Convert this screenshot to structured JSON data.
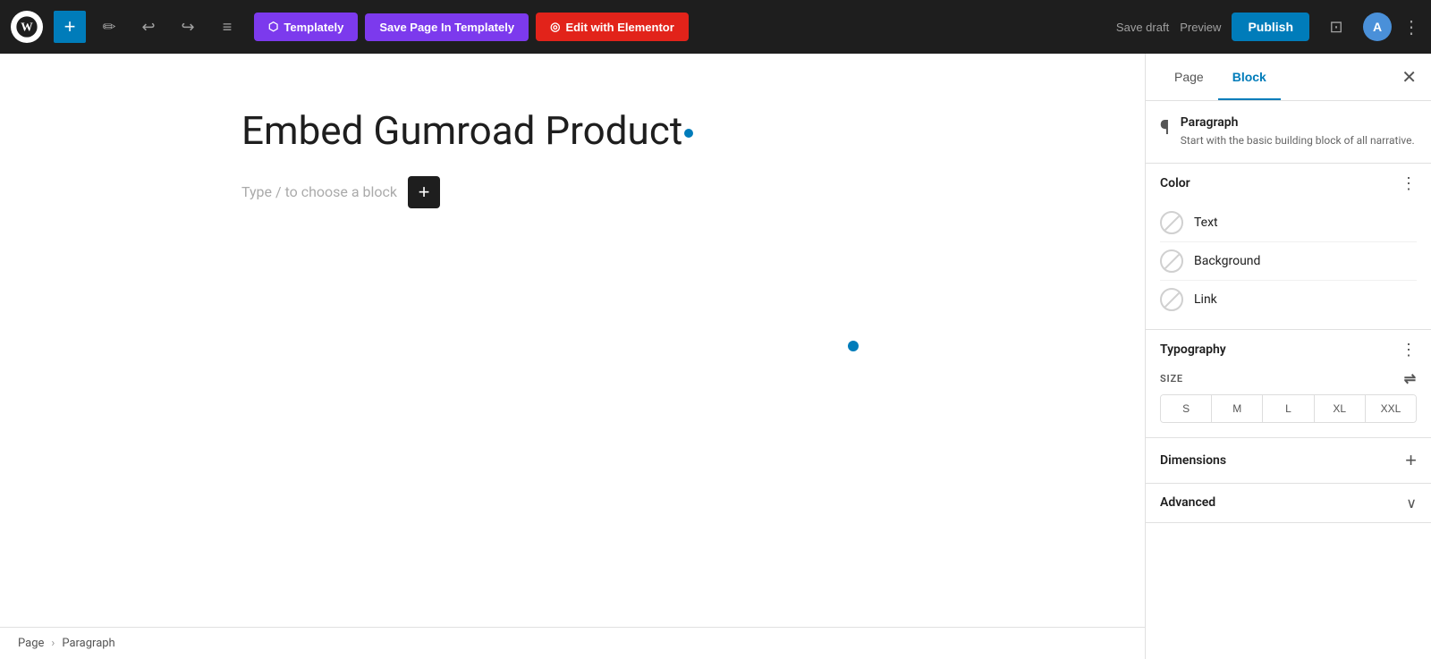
{
  "topbar": {
    "add_btn_label": "+",
    "pencil_icon": "✏",
    "undo_icon": "↩",
    "redo_icon": "↪",
    "list_icon": "≡",
    "templately_btn": "Templately",
    "save_page_btn": "Save Page In Templately",
    "elementor_btn": "Edit with Elementor",
    "save_draft_btn": "Save draft",
    "preview_btn": "Preview",
    "publish_btn": "Publish",
    "layout_icon": "⬜",
    "more_icon": "⋮"
  },
  "editor": {
    "page_title": "Embed Gumroad Product",
    "placeholder_text": "Type / to choose a block"
  },
  "breadcrumb": {
    "page_label": "Page",
    "separator": "›",
    "block_label": "Paragraph"
  },
  "panel": {
    "page_tab": "Page",
    "block_tab": "Block",
    "close_icon": "✕",
    "block_name": "Paragraph",
    "block_description": "Start with the basic building block of all narrative.",
    "color_section_title": "Color",
    "color_menu_icon": "⋮",
    "colors": [
      {
        "label": "Text",
        "has_slash": true
      },
      {
        "label": "Background",
        "has_slash": true
      },
      {
        "label": "Link",
        "has_slash": true
      }
    ],
    "typography_section_title": "Typography",
    "typography_menu_icon": "⋮",
    "size_label": "SIZE",
    "size_filter_icon": "⇌",
    "size_options": [
      "S",
      "M",
      "L",
      "XL",
      "XXL"
    ],
    "dimensions_title": "Dimensions",
    "dimensions_add_icon": "+",
    "advanced_title": "Advanced",
    "advanced_chevron": "∨"
  },
  "colors": {
    "accent": "#007cba",
    "publish_bg": "#007cba",
    "templately_bg": "#7c3aed",
    "elementor_bg": "#e2231a"
  }
}
